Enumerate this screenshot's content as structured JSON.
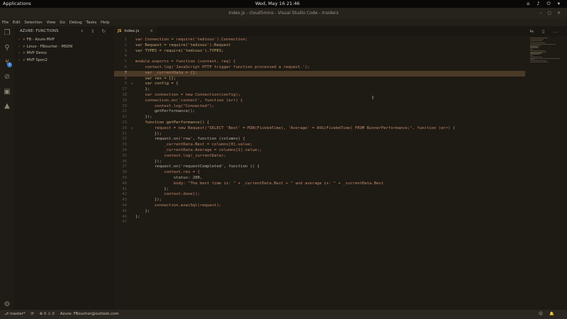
{
  "system_bar": {
    "apps_label": "Applications",
    "clock": "Wed, May 16   21:46",
    "tray": "⌂ ♪ ⏻ ▾"
  },
  "window": {
    "title": "index.js - cloud5mins - Visual Studio Code - Insiders",
    "controls": "– ▢ ✕"
  },
  "menu": [
    "File",
    "Edit",
    "Selection",
    "View",
    "Go",
    "Debug",
    "Tasks",
    "Help"
  ],
  "activity_bar": {
    "icons": [
      "files-icon",
      "search-icon",
      "source-control-icon",
      "debug-icon",
      "extensions-icon",
      "azure-icon",
      "settings-gear-icon"
    ],
    "badge": "1"
  },
  "sidebar": {
    "header": "AZURE: FUNCTIONS",
    "tools": "⚡ ⇪ ↻",
    "items": [
      {
        "label": "FB - Azure MVP"
      },
      {
        "label": "Linux - FBoucher - MSDN"
      },
      {
        "label": "MVP Demo"
      },
      {
        "label": "MVP Spon2"
      }
    ]
  },
  "editor": {
    "tab_label": "index.js",
    "tab_icon": "JS",
    "tab_close": "×",
    "tab_actions": "⇆ ▯ …",
    "lines": [
      {
        "n": "1",
        "text": "var Connection = require('tedious').Connection;"
      },
      {
        "n": "2",
        "text": "var Request = require('tedious').Request"
      },
      {
        "n": "3",
        "text": "var TYPES = require('tedious').TYPES;"
      },
      {
        "n": "4",
        "text": ""
      },
      {
        "n": "5",
        "text": "module.exports = function (context, req) {"
      },
      {
        "n": "6",
        "text": "    context.log('JavaScript HTTP trigger function processed a request.');"
      },
      {
        "n": "7",
        "text": "    var _currentData = {};"
      },
      {
        "n": "8",
        "text": "    var res = {};"
      },
      {
        "n": "9",
        "text": "    var config = {"
      },
      {
        "n": "17",
        "text": "    };"
      },
      {
        "n": "18",
        "text": "    var connection = new Connection(config);"
      },
      {
        "n": "19",
        "text": "    connection.on('connect', function (err) {"
      },
      {
        "n": "20",
        "text": "        context.log(\"Connected\");"
      },
      {
        "n": "21",
        "text": "        getPerformance();"
      },
      {
        "n": "22",
        "text": "    });"
      },
      {
        "n": "23",
        "text": "    function getPerformance() {"
      },
      {
        "n": "24",
        "text": "        request = new Request(\"SELECT 'Best' = MIN(FivekmTime), 'Average' = AVG(FivekmTime) FROM RunnerPerformance;\", function (err) {"
      },
      {
        "n": "31",
        "text": "        });"
      },
      {
        "n": "32",
        "text": "        request.on('row', function (columns) {"
      },
      {
        "n": "33",
        "text": "            _currentData.Best = columns[0].value;"
      },
      {
        "n": "34",
        "text": "            _currentData.Average = columns[1].value;;"
      },
      {
        "n": "35",
        "text": "            context.log(_currentData);"
      },
      {
        "n": "36",
        "text": "        });"
      },
      {
        "n": "37",
        "text": "        request.on('requestCompleted', function () {"
      },
      {
        "n": "38",
        "text": "            context.res = {"
      },
      {
        "n": "39",
        "text": "                status: 200,"
      },
      {
        "n": "40",
        "text": "                body: \"The best time is: \" + _currentData.Best + \" and average is: \" + _currentData.Best"
      },
      {
        "n": "41",
        "text": "            };"
      },
      {
        "n": "42",
        "text": "            context.done();"
      },
      {
        "n": "43",
        "text": "        });"
      },
      {
        "n": "44",
        "text": "        connection.execSql(request);"
      },
      {
        "n": "45",
        "text": "    };"
      },
      {
        "n": "46",
        "text": "};"
      },
      {
        "n": "47",
        "text": ""
      }
    ]
  },
  "statusbar": {
    "branch": "⎇ master*",
    "sync": "⟳",
    "problems": "⊗ 0  ⚠ 0",
    "account": "Azure: FBoucher@outlook.com",
    "right_icons": "☺ 🔔"
  }
}
